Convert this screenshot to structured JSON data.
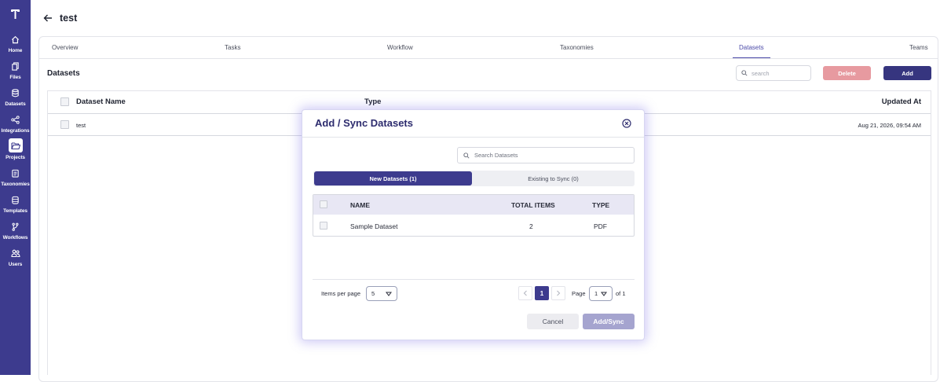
{
  "sidebar": {
    "items": [
      {
        "label": "Home",
        "icon": "home-icon"
      },
      {
        "label": "Files",
        "icon": "files-icon"
      },
      {
        "label": "Datasets",
        "icon": "database-icon"
      },
      {
        "label": "Integrations",
        "icon": "share-icon"
      },
      {
        "label": "Projects",
        "icon": "folder-open-icon",
        "active": true
      },
      {
        "label": "Taxonomies",
        "icon": "clipboard-icon"
      },
      {
        "label": "Templates",
        "icon": "template-icon"
      },
      {
        "label": "Workflows",
        "icon": "branch-icon"
      },
      {
        "label": "Users",
        "icon": "users-icon"
      }
    ]
  },
  "header": {
    "title": "test"
  },
  "tabs": [
    "Overview",
    "Tasks",
    "Workflow",
    "Taxonomies",
    "Datasets",
    "Teams"
  ],
  "active_tab": "Datasets",
  "section": {
    "title": "Datasets",
    "search_placeholder": "search",
    "delete_label": "Delete",
    "add_label": "Add"
  },
  "table": {
    "headers": [
      "Dataset Name",
      "Type",
      "Updated At"
    ],
    "rows": [
      {
        "name": "test",
        "updated_at": "Aug 21, 2026, 09:54 AM"
      }
    ]
  },
  "modal": {
    "title": "Add / Sync Datasets",
    "search_placeholder": "Search Datasets",
    "tab_new": "New Datasets (1)",
    "tab_existing": "Existing to Sync (0)",
    "headers": [
      "NAME",
      "TOTAL ITEMS",
      "TYPE"
    ],
    "rows": [
      {
        "name": "Sample Dataset",
        "total_items": "2",
        "type": "PDF"
      }
    ],
    "items_per_page_label": "Items per page",
    "items_per_page_value": "5",
    "current_page": "1",
    "page_label": "Page",
    "page_select_value": "1",
    "of_label": "of 1",
    "cancel_label": "Cancel",
    "submit_label": "Add/Sync"
  },
  "colors": {
    "sidebar": "#3d3b8e",
    "primary": "#36357f",
    "danger_disabled": "#e79aa0",
    "accent_tab": "#4b4aa8"
  }
}
